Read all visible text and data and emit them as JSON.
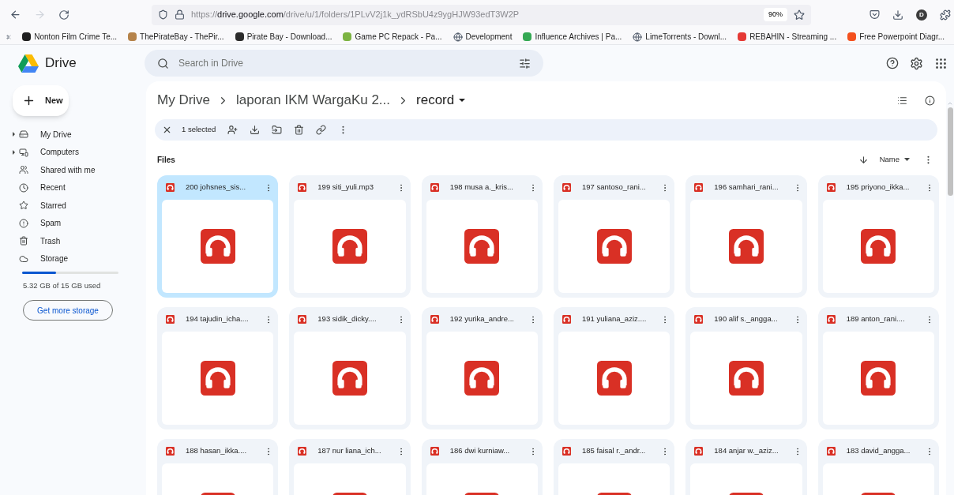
{
  "browser": {
    "url": "https://**drive.google.com**/drive/u/1/folders/1PLvV2j1k_ydRSbU4z9ygHJW93edT3W2P",
    "zoom": "90%",
    "profile_initial": "D",
    "bookmarks": [
      {
        "kind": "favicon",
        "color": "#1f1f1f",
        "label": "Nonton Film Crime Te..."
      },
      {
        "kind": "favicon",
        "color": "#b5834a",
        "label": "ThePirateBay - ThePir..."
      },
      {
        "kind": "favicon",
        "color": "#2b2b2b",
        "label": "Pirate Bay - Download..."
      },
      {
        "kind": "favicon",
        "color": "#7cb342",
        "label": "Game PC Repack - Pa..."
      },
      {
        "kind": "globe",
        "label": "Development"
      },
      {
        "kind": "favicon",
        "color": "#34a853",
        "label": "Influence Archives | Pa..."
      },
      {
        "kind": "globe",
        "label": "LimeTorrents - Downl..."
      },
      {
        "kind": "favicon",
        "color": "#e53935",
        "label": "REBAHIN - Streaming ..."
      },
      {
        "kind": "favicon",
        "color": "#f4511e",
        "label": "Free Powerpoint Diagr..."
      }
    ]
  },
  "app": {
    "name": "Drive",
    "search": {
      "placeholder": "Search in Drive"
    }
  },
  "sidebar": {
    "new_button": "New",
    "items": [
      {
        "kind": "drive",
        "label": "My Drive",
        "expandable": true,
        "selected": false
      },
      {
        "kind": "computers",
        "label": "Computers",
        "expandable": true,
        "selected": false
      },
      {
        "kind": "shared",
        "label": "Shared with me",
        "expandable": false,
        "selected": false
      },
      {
        "kind": "recent",
        "label": "Recent",
        "expandable": false,
        "selected": false
      },
      {
        "kind": "starred",
        "label": "Starred",
        "expandable": false,
        "selected": false
      },
      {
        "kind": "spam",
        "label": "Spam",
        "expandable": false,
        "selected": false
      },
      {
        "kind": "trash",
        "label": "Trash",
        "expandable": false,
        "selected": false
      },
      {
        "kind": "storage",
        "label": "Storage",
        "expandable": false,
        "selected": false
      }
    ],
    "storage": {
      "level": 0.355,
      "usage": "5.32 GB of 15 GB used",
      "button": "Get more storage"
    }
  },
  "breadcrumb": [
    {
      "label": "My Drive",
      "current": false
    },
    {
      "label": "laporan IKM WargaKu 2...",
      "current": false
    },
    {
      "label": "record",
      "current": true
    }
  ],
  "selection_bar": {
    "count": "1 selected"
  },
  "section_title": "Files",
  "sort": {
    "label": "Name"
  },
  "files": [
    {
      "name": "200 johsnes_sis...",
      "selected": true
    },
    {
      "name": "199 siti_yuli.mp3",
      "selected": false
    },
    {
      "name": "198 musa a._kris...",
      "selected": false
    },
    {
      "name": "197 santoso_rani...",
      "selected": false
    },
    {
      "name": "196 samhari_rani...",
      "selected": false
    },
    {
      "name": "195 priyono_ikka...",
      "selected": false
    },
    {
      "name": "194 tajudin_icha....",
      "selected": false
    },
    {
      "name": "193 sidik_dicky....",
      "selected": false
    },
    {
      "name": "192 yurika_andre...",
      "selected": false
    },
    {
      "name": "191 yuliana_aziz....",
      "selected": false
    },
    {
      "name": "190 alif s._angga...",
      "selected": false
    },
    {
      "name": "189 anton_rani....",
      "selected": false
    },
    {
      "name": "188 hasan_ikka....",
      "selected": false
    },
    {
      "name": "187 nur liana_ich...",
      "selected": false
    },
    {
      "name": "186 dwi kurniaw...",
      "selected": false
    },
    {
      "name": "185 faisal r._andr...",
      "selected": false
    },
    {
      "name": "184 anjar w._aziz...",
      "selected": false
    },
    {
      "name": "183 david_angga...",
      "selected": false
    }
  ]
}
